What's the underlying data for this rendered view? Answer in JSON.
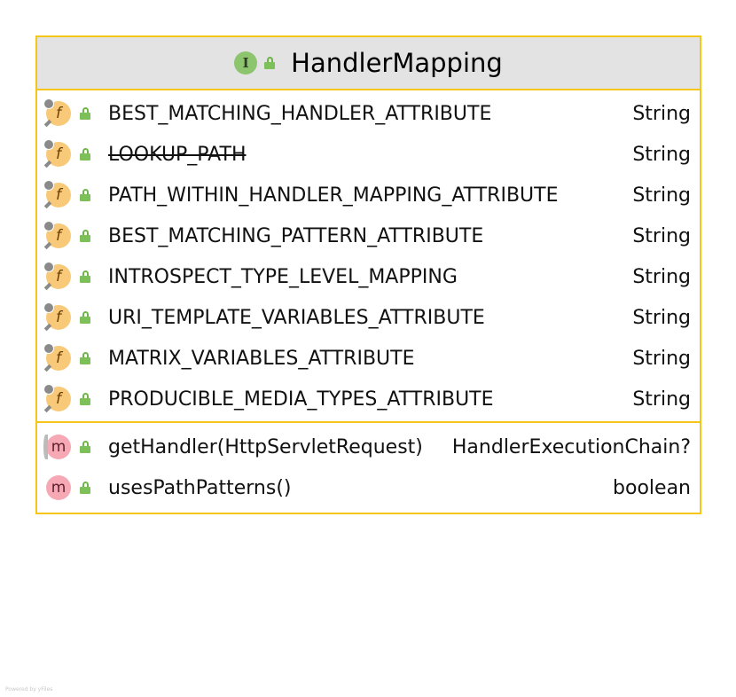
{
  "class": {
    "name": "HandlerMapping",
    "kind_icon": "interface-icon",
    "kind_letter": "I"
  },
  "fields": [
    {
      "name": "BEST_MATCHING_HANDLER_ATTRIBUTE",
      "type": "String",
      "deprecated": false
    },
    {
      "name": "LOOKUP_PATH",
      "type": "String",
      "deprecated": true
    },
    {
      "name": "PATH_WITHIN_HANDLER_MAPPING_ATTRIBUTE",
      "type": "String",
      "deprecated": false
    },
    {
      "name": "BEST_MATCHING_PATTERN_ATTRIBUTE",
      "type": "String",
      "deprecated": false
    },
    {
      "name": "INTROSPECT_TYPE_LEVEL_MAPPING",
      "type": "String",
      "deprecated": false
    },
    {
      "name": "URI_TEMPLATE_VARIABLES_ATTRIBUTE",
      "type": "String",
      "deprecated": false
    },
    {
      "name": "MATRIX_VARIABLES_ATTRIBUTE",
      "type": "String",
      "deprecated": false
    },
    {
      "name": "PRODUCIBLE_MEDIA_TYPES_ATTRIBUTE",
      "type": "String",
      "deprecated": false
    }
  ],
  "field_icon_letter": "f",
  "methods": [
    {
      "name": "getHandler(HttpServletRequest)",
      "type": "HandlerExecutionChain?",
      "abstract": true
    },
    {
      "name": "usesPathPatterns()",
      "type": "boolean",
      "abstract": false
    }
  ],
  "method_icon_letter": "m",
  "footer": "Powered by yFiles",
  "colors": {
    "border": "#f5c518",
    "header_bg": "#e3e3e3",
    "interface_icon": "#8cc56d",
    "field_icon": "#f9c97a",
    "method_icon": "#f6a9b5",
    "public_lock": "#7dc05a"
  }
}
